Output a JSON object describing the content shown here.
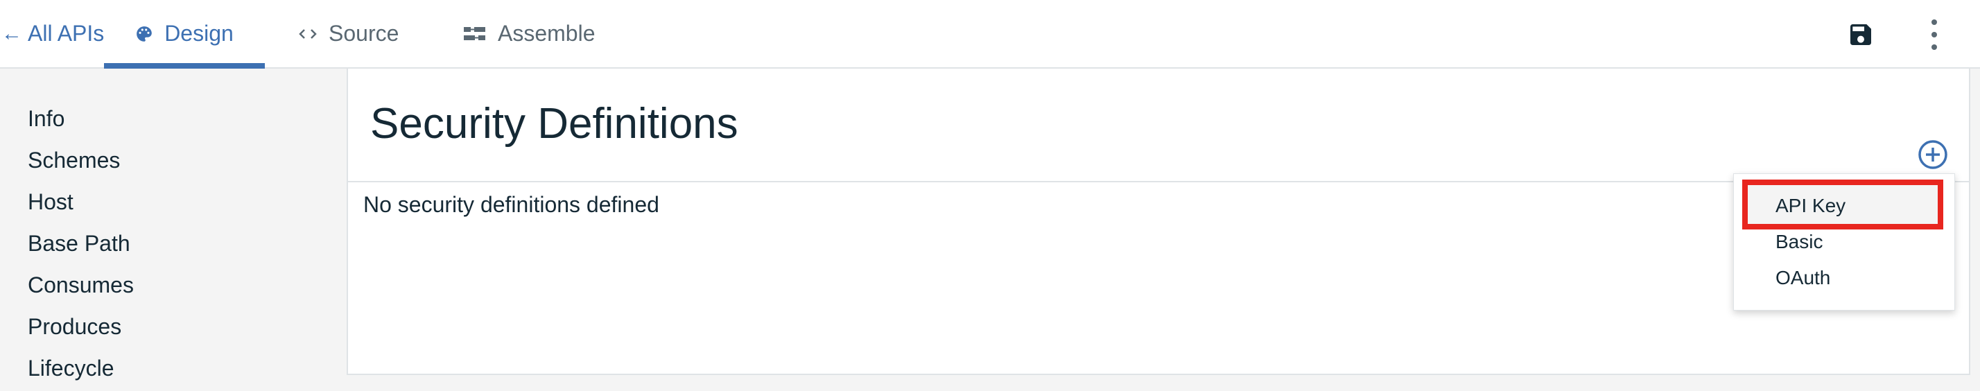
{
  "nav": {
    "back_label": "All APIs",
    "back_arrow": "←",
    "tabs": [
      {
        "label": "Design",
        "icon": "palette-icon",
        "active": true
      },
      {
        "label": "Source",
        "icon": "code-icon",
        "active": false
      },
      {
        "label": "Assemble",
        "icon": "assemble-icon",
        "active": false
      }
    ],
    "save_icon": "save-icon",
    "more_icon": "overflow-menu-icon"
  },
  "sidebar": {
    "items": [
      {
        "label": "Info"
      },
      {
        "label": "Schemes"
      },
      {
        "label": "Host"
      },
      {
        "label": "Base Path"
      },
      {
        "label": "Consumes"
      },
      {
        "label": "Produces"
      },
      {
        "label": "Lifecycle"
      }
    ]
  },
  "main": {
    "title": "Security Definitions",
    "empty_text": "No security definitions defined",
    "add_icon": "add-circle-icon"
  },
  "menu": {
    "items": [
      {
        "label": "API Key",
        "highlighted": true
      },
      {
        "label": "Basic",
        "highlighted": false
      },
      {
        "label": "OAuth",
        "highlighted": false
      }
    ]
  },
  "colors": {
    "accent": "#3d70b2",
    "highlight_border": "#e8261f",
    "text": "#152935",
    "muted": "#5a6872"
  }
}
